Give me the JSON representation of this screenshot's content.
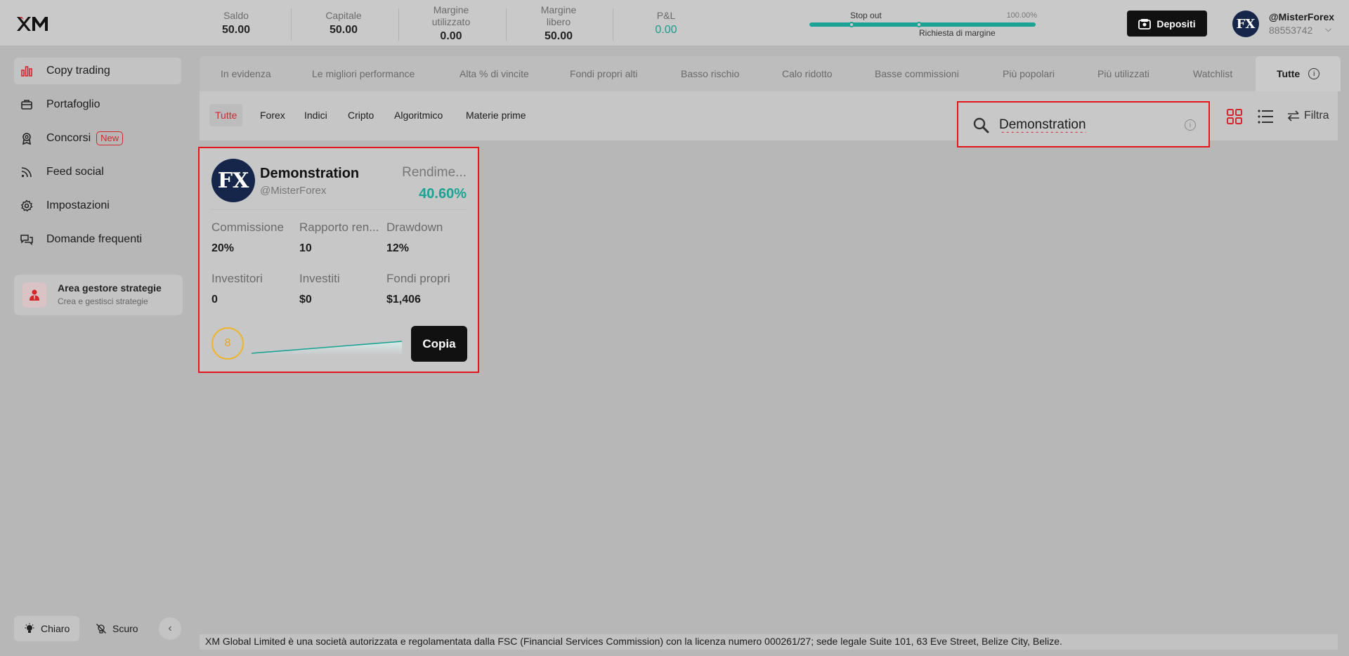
{
  "header": {
    "logo_text": "XM",
    "stats": [
      {
        "label": "Saldo",
        "value": "50.00"
      },
      {
        "label": "Capitale",
        "value": "50.00"
      },
      {
        "label": "Margine utilizzato",
        "value": "0.00"
      },
      {
        "label": "Margine libero",
        "value": "50.00"
      },
      {
        "label": "P&L",
        "value": "0.00"
      }
    ],
    "margin": {
      "stop_out": "Stop out",
      "percent": "100.00%",
      "label": "Richiesta di margine"
    },
    "deposit_label": "Depositi",
    "user": {
      "avatar": "FX",
      "name": "@MisterForex",
      "id": "88553742"
    }
  },
  "sidebar": {
    "items": [
      {
        "label": "Copy trading",
        "icon": "bar-chart-icon"
      },
      {
        "label": "Portafoglio",
        "icon": "briefcase-icon"
      },
      {
        "label": "Concorsi",
        "icon": "medal-icon",
        "badge": "New"
      },
      {
        "label": "Feed social",
        "icon": "feed-icon"
      },
      {
        "label": "Impostazioni",
        "icon": "gear-icon"
      },
      {
        "label": "Domande frequenti",
        "icon": "chat-icon"
      }
    ],
    "strategy": {
      "title": "Area gestore strategie",
      "subtitle": "Crea e gestisci strategie"
    },
    "theme": {
      "light": "Chiaro",
      "dark": "Scuro"
    }
  },
  "tabs": [
    "In evidenza",
    "Le migliori performance",
    "Alta % di vincite",
    "Fondi propri alti",
    "Basso rischio",
    "Calo ridotto",
    "Basse commissioni",
    "Più popolari",
    "Più utilizzati",
    "Watchlist",
    "Tutte"
  ],
  "filters": [
    "Tutte",
    "Forex",
    "Indici",
    "Cripto",
    "Algoritmico",
    "Materie prime"
  ],
  "search": {
    "value": "Demonstration"
  },
  "filter_label": "Filtra",
  "card": {
    "avatar": "FX",
    "name": "Demonstration",
    "handle": "@MisterForex",
    "return_label": "Rendime...",
    "return_value": "40.60%",
    "metrics": [
      {
        "label": "Commissione",
        "value": "20%"
      },
      {
        "label": "Rapporto ren...",
        "value": "10"
      },
      {
        "label": "Drawdown",
        "value": "12%"
      },
      {
        "label": "Investitori",
        "value": "0"
      },
      {
        "label": "Investiti",
        "value": "$0"
      },
      {
        "label": "Fondi propri",
        "value": "$1,406"
      }
    ],
    "score": "8",
    "copy_label": "Copia"
  },
  "footer": "XM Global Limited è una società autorizzata e regolamentata dalla FSC (Financial Services Commission) con la licenza numero 000261/27; sede legale Suite 101, 63 Eve Street, Belize City, Belize.",
  "colors": {
    "accent": "#d4262b",
    "positive": "#1aa394",
    "highlight": "#e4151b",
    "score": "#f0b429"
  }
}
